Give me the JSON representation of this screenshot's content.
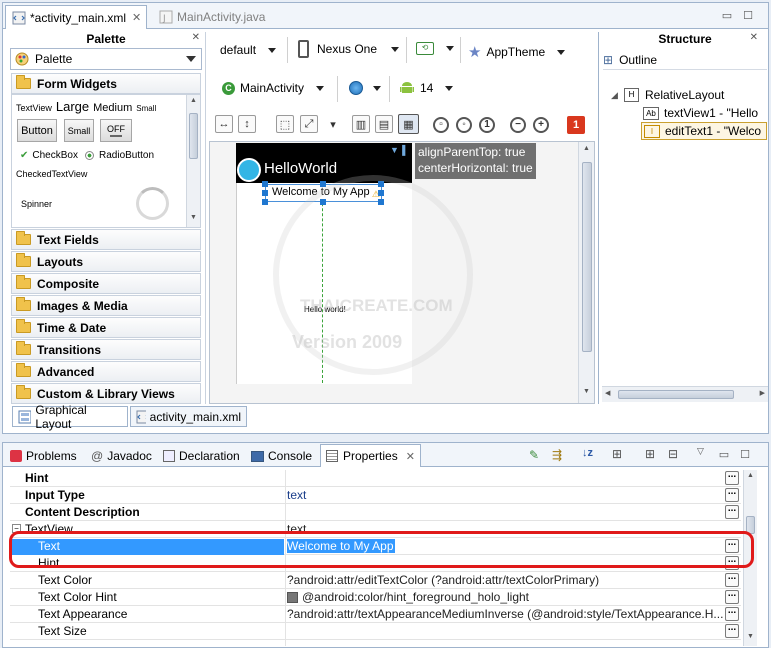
{
  "editor_tabs": [
    {
      "label": "*activity_main.xml",
      "active": true
    },
    {
      "label": "MainActivity.java",
      "active": false
    }
  ],
  "palette": {
    "title": "Palette",
    "dropdown_label": "Palette",
    "form_widgets_label": "Form Widgets",
    "widgets": {
      "textview": "TextView",
      "large": "Large",
      "medium": "Medium",
      "small": "Small",
      "button": "Button",
      "small_button": "Small",
      "toggle": "OFF",
      "checkbox": "CheckBox",
      "radiobutton": "RadioButton",
      "checkedtextview": "CheckedTextView",
      "spinner": "Spinner"
    },
    "categories": [
      "Text Fields",
      "Layouts",
      "Composite",
      "Images & Media",
      "Time & Date",
      "Transitions",
      "Advanced",
      "Custom & Library Views"
    ]
  },
  "sub_tabs": [
    {
      "label": "Graphical Layout",
      "active": true
    },
    {
      "label": "activity_main.xml",
      "active": false
    }
  ],
  "canvas_toolbar": {
    "config": "default",
    "device": "Nexus One",
    "theme": "AppTheme",
    "activity": "MainActivity",
    "api_level": "14",
    "error_count": "1"
  },
  "canvas": {
    "app_title": "HelloWorld",
    "edit_text": "Welcome to My App",
    "hello_text": "Hello world!",
    "layout_hint_line1": "alignParentTop: true",
    "layout_hint_line2": "centerHorizontal: true",
    "watermark_line1": "THAICREATE.COM",
    "watermark_line2": "Version 2009"
  },
  "structure": {
    "title": "Structure",
    "outline_label": "Outline",
    "root": "RelativeLayout",
    "children": [
      {
        "label": "textView1 - \"Hello",
        "badge": "Ab"
      },
      {
        "label": "editText1 - \"Welco",
        "badge": "I"
      }
    ]
  },
  "bottom_tabs": [
    "Problems",
    "Javadoc",
    "Declaration",
    "Console",
    "Properties"
  ],
  "properties": [
    {
      "name": "Hint",
      "value": "",
      "bold": true
    },
    {
      "name": "Input Type",
      "value": "text",
      "bold": true
    },
    {
      "name": "Content Description",
      "value": "",
      "bold": true
    },
    {
      "name": "TextView",
      "value": "text",
      "bold": false,
      "group": true
    },
    {
      "name": "Text",
      "value": "Welcome to My App",
      "bold": false,
      "selected": true
    },
    {
      "name": "Hint",
      "value": "",
      "bold": false
    },
    {
      "name": "Text Color",
      "value": "?android:attr/editTextColor (?android:attr/textColorPrimary)",
      "bold": false
    },
    {
      "name": "Text Color Hint",
      "value": "@android:color/hint_foreground_holo_light",
      "bold": false
    },
    {
      "name": "Text Appearance",
      "value": "?android:attr/textAppearanceMediumInverse (@android:style/TextAppearance.H...",
      "bold": false
    },
    {
      "name": "Text Size",
      "value": "",
      "bold": false
    }
  ],
  "colors": {
    "selection": "#3399ff",
    "highlight": "#e01a1a",
    "holo_blue": "#33b5e5"
  }
}
